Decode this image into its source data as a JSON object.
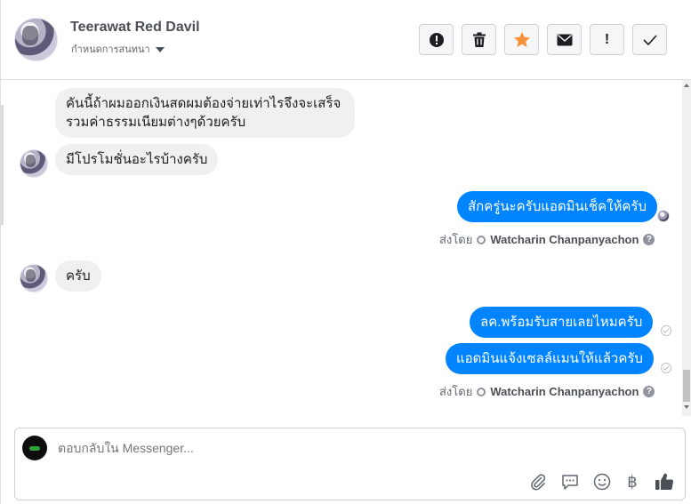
{
  "header": {
    "contact_name": "Teerawat Red Davil",
    "contact_sub": "กำหนดการสนทนา",
    "buttons": [
      {
        "icon": "alert-circle-icon"
      },
      {
        "icon": "trash-icon"
      },
      {
        "icon": "star-icon",
        "color": "#f7923b"
      },
      {
        "icon": "envelope-icon"
      },
      {
        "icon": "exclamation-icon",
        "label": "!"
      },
      {
        "icon": "check-icon"
      }
    ]
  },
  "messages": {
    "m1_line1": "คันนี้ถ้าผมออกเงินสดผมต้องจ่ายเท่าไรจึงจะเสร็จ",
    "m1_line2": "รวมค่าธรรมเนียมต่างๆด้วยครับ",
    "m2": "มีโปรโมชั่นอะไรบ้างครับ",
    "m3": "สักครู่นะครับแอดมินเช็คให้ครับ",
    "m4": "ครับ",
    "m5": "ลค.พร้อมรับสายเลยไหมครับ",
    "m6": "แอดมินแจ้งเซลล์แมนให้แล้วครับ"
  },
  "sent_by": {
    "prefix": "ส่งโดย",
    "name": "Watcharin Chanpanyachon",
    "help": "?"
  },
  "composer": {
    "placeholder": "ตอบกลับใน Messenger..."
  },
  "tools": {
    "currency_symbol": "฿"
  },
  "colors": {
    "outgoing_bubble": "#0084ff",
    "incoming_bubble": "#f1f0f0",
    "star": "#f7923b"
  }
}
